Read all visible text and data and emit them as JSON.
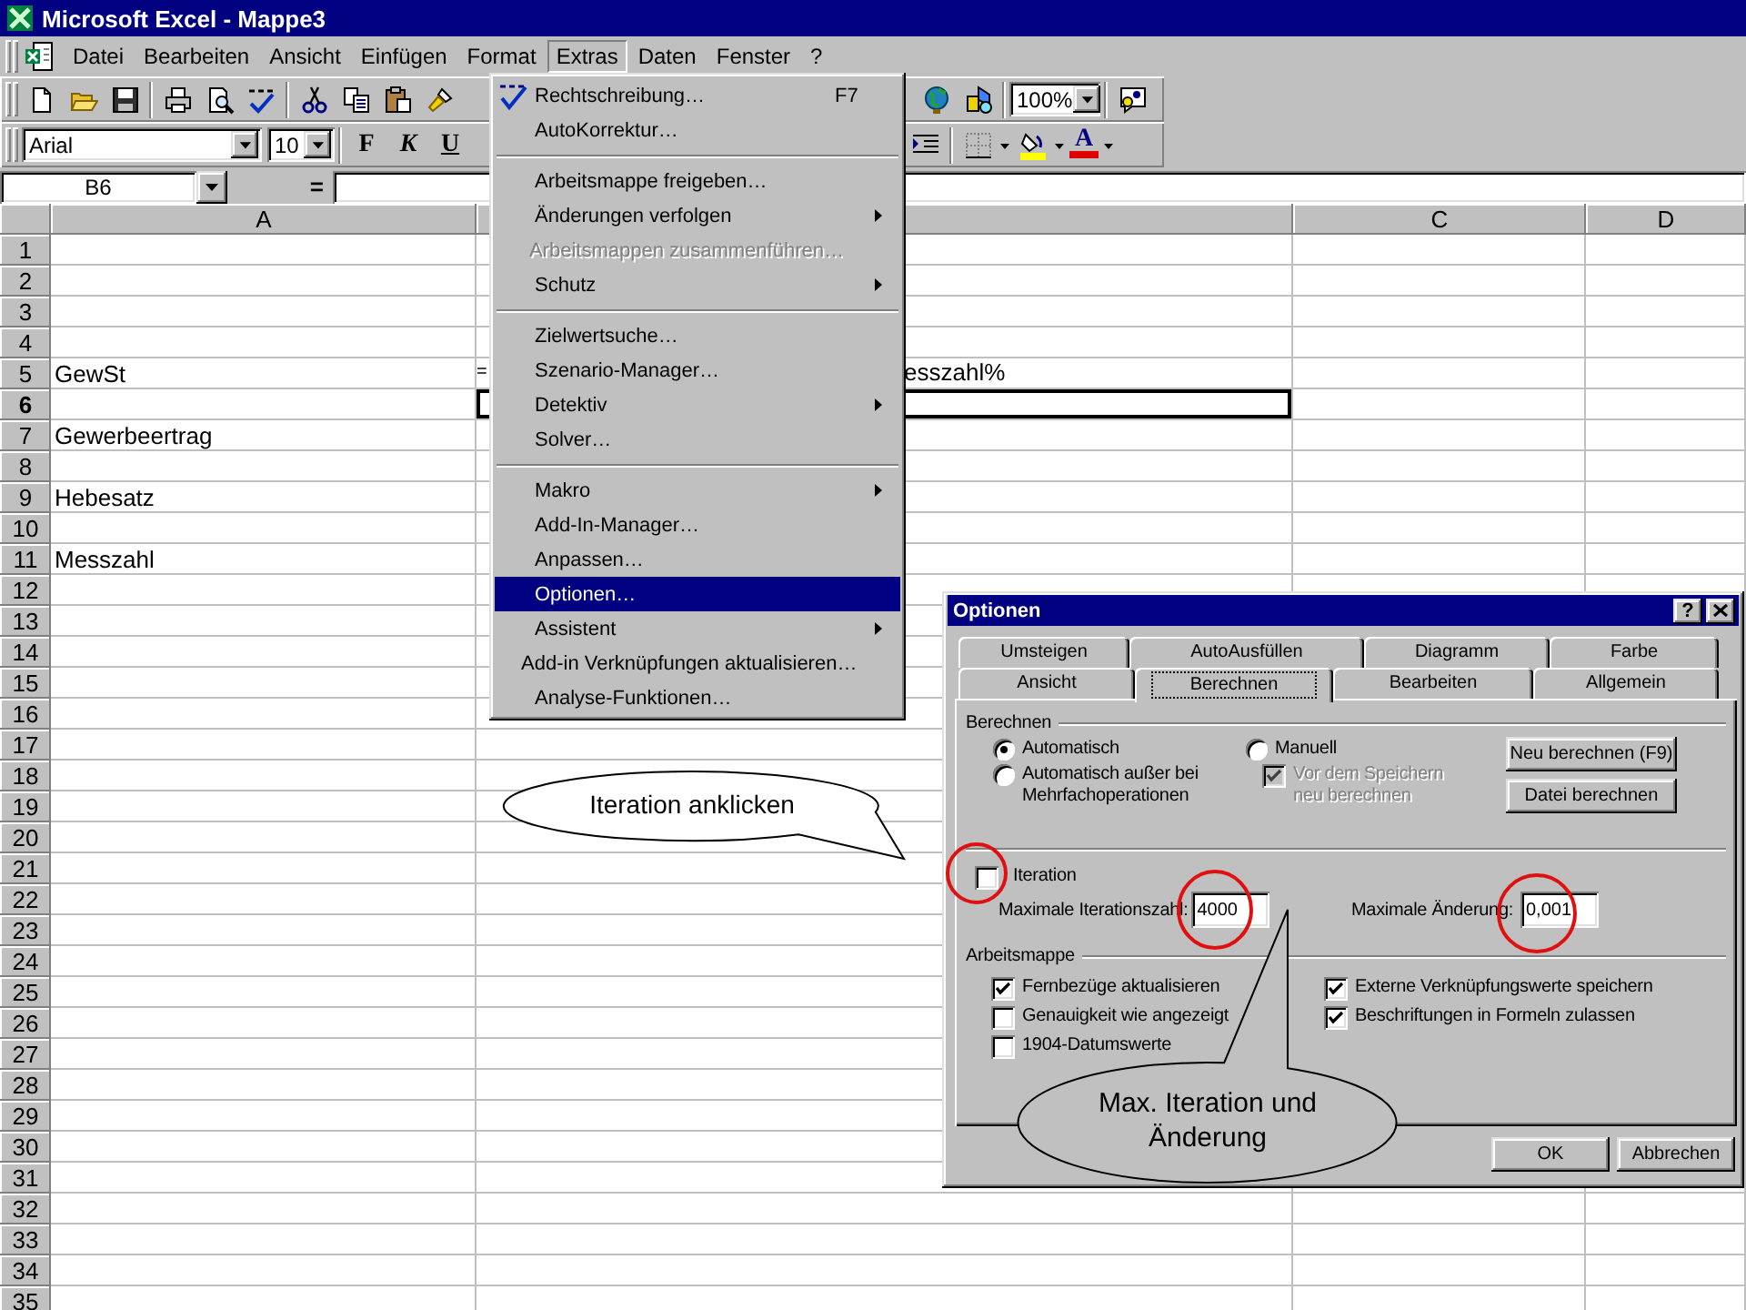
{
  "window": {
    "title": "Microsoft Excel - Mappe3"
  },
  "menu_bar": [
    {
      "label": "Datei",
      "selected": false
    },
    {
      "label": "Bearbeiten",
      "selected": false
    },
    {
      "label": "Ansicht",
      "selected": false
    },
    {
      "label": "Einfügen",
      "selected": false
    },
    {
      "label": "Format",
      "selected": false
    },
    {
      "label": "Extras",
      "selected": true
    },
    {
      "label": "Daten",
      "selected": false
    },
    {
      "label": "Fenster",
      "selected": false
    },
    {
      "label": "?",
      "selected": false
    }
  ],
  "standard_toolbar": {
    "zoom": "100%"
  },
  "formatting_toolbar": {
    "font": "Arial",
    "size": "10",
    "style_buttons": [
      "F",
      "K",
      "U"
    ],
    "font_color_button": "A"
  },
  "formula_bar": {
    "name_box": "B6",
    "equals_button": "="
  },
  "sheet": {
    "columns": [
      "A",
      null,
      "C",
      "D"
    ],
    "rows": [
      {
        "header": "1",
        "selected": false
      },
      {
        "header": "2",
        "selected": false
      },
      {
        "header": "3",
        "selected": false
      },
      {
        "header": "4",
        "selected": false
      },
      {
        "header": "5",
        "selected": false,
        "a": "GewSt",
        "b_parts": [
          "=",
          "esszahl%"
        ]
      },
      {
        "header": "6",
        "selected": true
      },
      {
        "header": "7",
        "selected": false,
        "a": "Gewerbeertrag"
      },
      {
        "header": "8",
        "selected": false
      },
      {
        "header": "9",
        "selected": false,
        "a": "Hebesatz"
      },
      {
        "header": "10",
        "selected": false
      },
      {
        "header": "11",
        "selected": false,
        "a": "Messzahl"
      },
      {
        "header": "12",
        "selected": false
      },
      {
        "header": "13",
        "selected": false
      },
      {
        "header": "14",
        "selected": false
      },
      {
        "header": "15",
        "selected": false
      },
      {
        "header": "16",
        "selected": false
      },
      {
        "header": "17",
        "selected": false
      },
      {
        "header": "18",
        "selected": false
      },
      {
        "header": "19",
        "selected": false
      },
      {
        "header": "20",
        "selected": false
      },
      {
        "header": "21",
        "selected": false
      },
      {
        "header": "22",
        "selected": false
      },
      {
        "header": "23",
        "selected": false
      },
      {
        "header": "24",
        "selected": false
      },
      {
        "header": "25",
        "selected": false
      },
      {
        "header": "26",
        "selected": false
      },
      {
        "header": "27",
        "selected": false
      },
      {
        "header": "28",
        "selected": false
      },
      {
        "header": "29",
        "selected": false
      },
      {
        "header": "30",
        "selected": false
      },
      {
        "header": "31",
        "selected": false
      },
      {
        "header": "32",
        "selected": false
      },
      {
        "header": "33",
        "selected": false
      },
      {
        "header": "34",
        "selected": false
      },
      {
        "header": "35",
        "selected": false
      }
    ]
  },
  "extras_menu": {
    "items": [
      {
        "kind": "icon_item",
        "label": "Rechtschreibung…",
        "shortcut": "F7",
        "submenu": false,
        "disabled": false,
        "selected": false
      },
      {
        "kind": "item",
        "label": "AutoKorrektur…",
        "submenu": false,
        "disabled": false,
        "selected": false
      },
      {
        "kind": "separator"
      },
      {
        "kind": "item",
        "label": "Arbeitsmappe freigeben…",
        "submenu": false,
        "disabled": false,
        "selected": false
      },
      {
        "kind": "item",
        "label": "Änderungen verfolgen",
        "submenu": true,
        "disabled": false,
        "selected": false
      },
      {
        "kind": "item",
        "label": "Arbeitsmappen zusammenführen…",
        "submenu": false,
        "disabled": true,
        "selected": false
      },
      {
        "kind": "item",
        "label": "Schutz",
        "submenu": true,
        "disabled": false,
        "selected": false
      },
      {
        "kind": "separator"
      },
      {
        "kind": "item",
        "label": "Zielwertsuche…",
        "submenu": false,
        "disabled": false,
        "selected": false
      },
      {
        "kind": "item",
        "label": "Szenario-Manager…",
        "submenu": false,
        "disabled": false,
        "selected": false
      },
      {
        "kind": "item",
        "label": "Detektiv",
        "submenu": true,
        "disabled": false,
        "selected": false
      },
      {
        "kind": "item",
        "label": "Solver…",
        "submenu": false,
        "disabled": false,
        "selected": false
      },
      {
        "kind": "separator"
      },
      {
        "kind": "item",
        "label": "Makro",
        "submenu": true,
        "disabled": false,
        "selected": false
      },
      {
        "kind": "item",
        "label": "Add-In-Manager…",
        "submenu": false,
        "disabled": false,
        "selected": false
      },
      {
        "kind": "item",
        "label": "Anpassen…",
        "submenu": false,
        "disabled": false,
        "selected": false
      },
      {
        "kind": "item",
        "label": "Optionen…",
        "submenu": false,
        "disabled": false,
        "selected": true
      },
      {
        "kind": "item",
        "label": "Assistent",
        "submenu": true,
        "disabled": false,
        "selected": false
      },
      {
        "kind": "item",
        "label": "Add-in Verknüpfungen aktualisieren…",
        "submenu": false,
        "disabled": false,
        "selected": false
      },
      {
        "kind": "item",
        "label": "Analyse-Funktionen…",
        "submenu": false,
        "disabled": false,
        "selected": false
      }
    ]
  },
  "dialog": {
    "title": "Optionen",
    "help_button": "?",
    "tabs_back": [
      {
        "label": "Umsteigen",
        "selected": false
      },
      {
        "label": "AutoAusfüllen",
        "selected": false
      },
      {
        "label": "Diagramm",
        "selected": false
      },
      {
        "label": "Farbe",
        "selected": false
      }
    ],
    "tabs_front": [
      {
        "label": "Ansicht",
        "selected": false
      },
      {
        "label": "Berechnen",
        "selected": true
      },
      {
        "label": "Bearbeiten",
        "selected": false
      },
      {
        "label": "Allgemein",
        "selected": false
      }
    ],
    "calculation": {
      "title": "Berechnen",
      "options": [
        {
          "label": "Automatisch",
          "selected": true
        },
        {
          "label": "Automatisch außer bei Mehrfachoperationen",
          "selected": false
        },
        {
          "label": "Manuell",
          "selected": false
        }
      ],
      "recalc_before_save": {
        "label": "Vor dem Speichern neu berechnen",
        "checked": true,
        "disabled": true
      },
      "buttons": [
        "Neu berechnen (F9)",
        "Datei berechnen"
      ]
    },
    "iteration": {
      "label": "Iteration",
      "checked": false,
      "max_iterations_label": "Maximale Iterationszahl:",
      "max_iterations": "4000",
      "max_change_label": "Maximale Änderung:",
      "max_change": "0,001"
    },
    "workbook": {
      "title": "Arbeitsmappe",
      "left_options": [
        {
          "label": "Fernbezüge aktualisieren",
          "checked": true
        },
        {
          "label": "Genauigkeit wie angezeigt",
          "checked": false
        },
        {
          "label": "1904-Datumswerte",
          "checked": false
        }
      ],
      "right_options": [
        {
          "label": "Externe Verknüpfungswerte speichern",
          "checked": true
        },
        {
          "label": "Beschriftungen in Formeln zulassen",
          "checked": true
        }
      ]
    },
    "buttons": [
      "OK",
      "Abbrechen"
    ]
  },
  "annotations": [
    {
      "text": "Iteration anklicken"
    },
    {
      "text": "Max. Iteration und Änderung"
    }
  ]
}
